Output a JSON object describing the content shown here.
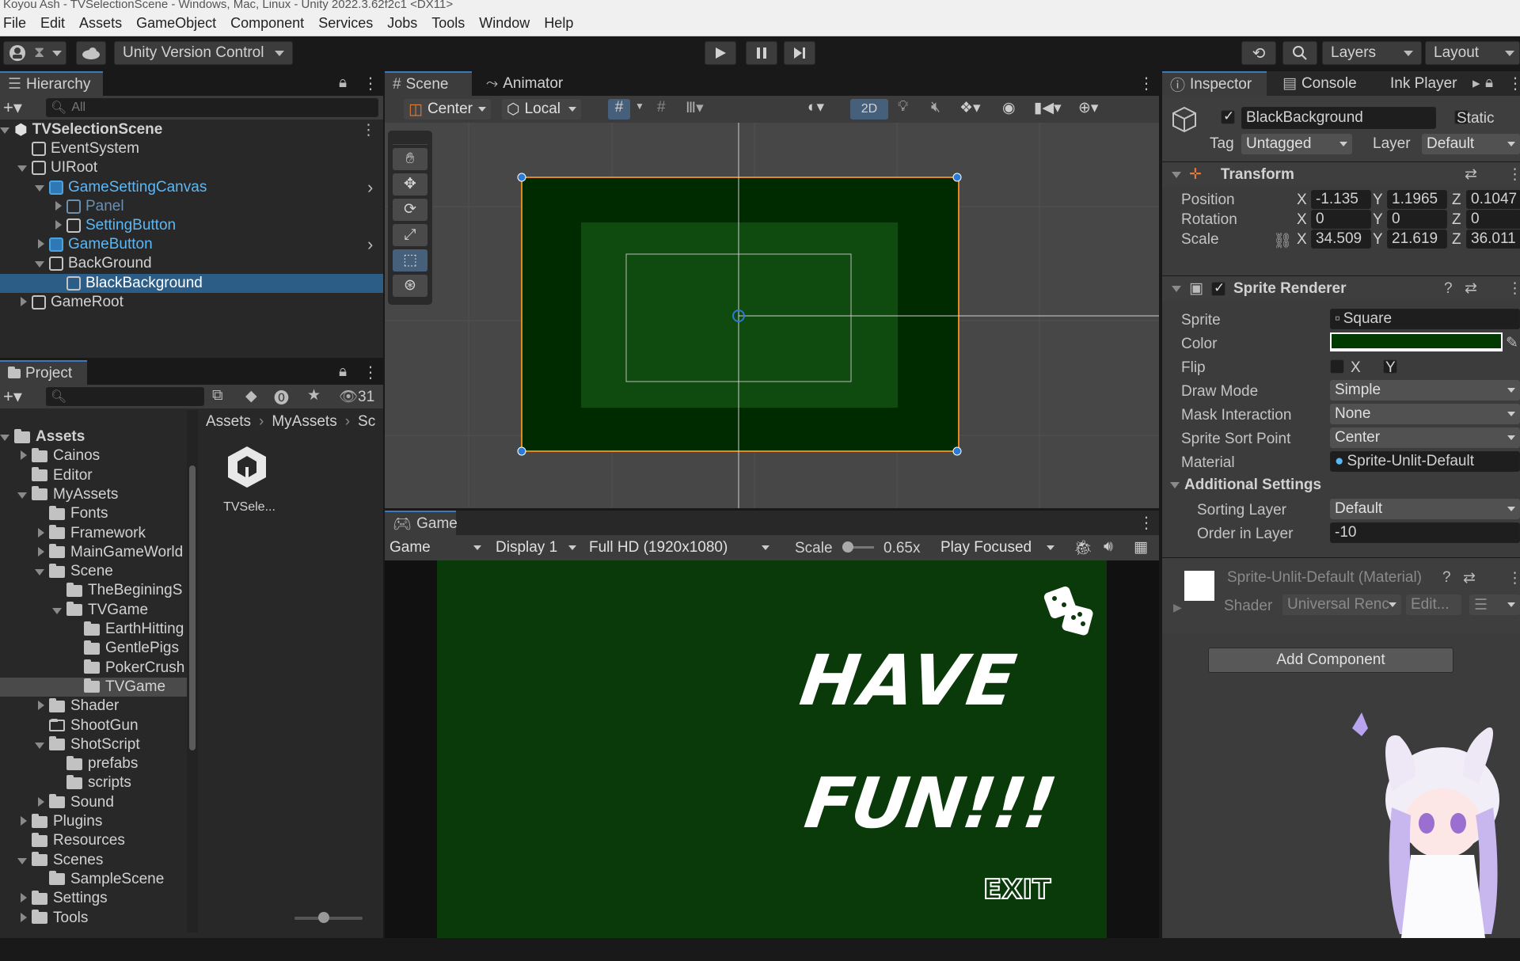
{
  "window": {
    "title": "Koyou Ash - TVSelectionScene - Windows, Mac, Linux - Unity 2022.3.62f2c1 <DX11>"
  },
  "menu": [
    "File",
    "Edit",
    "Assets",
    "GameObject",
    "Component",
    "Services",
    "Jobs",
    "Tools",
    "Window",
    "Help"
  ],
  "toolbar": {
    "version_control": "Unity Version Control",
    "layers": "Layers",
    "layout": "Layout"
  },
  "hierarchy": {
    "tab": "Hierarchy",
    "search_placeholder": "All",
    "items": [
      {
        "label": "TVSelectionScene",
        "depth": 0,
        "kind": "scene",
        "expanded": true
      },
      {
        "label": "EventSystem",
        "depth": 1,
        "kind": "object"
      },
      {
        "label": "UIRoot",
        "depth": 1,
        "kind": "object",
        "expanded": true
      },
      {
        "label": "GameSettingCanvas",
        "depth": 2,
        "kind": "prefab",
        "expanded": true
      },
      {
        "label": "Panel",
        "depth": 3,
        "kind": "inactive"
      },
      {
        "label": "SettingButton",
        "depth": 3,
        "kind": "prefab-child"
      },
      {
        "label": "GameButton",
        "depth": 2,
        "kind": "prefab"
      },
      {
        "label": "BackGround",
        "depth": 2,
        "kind": "object",
        "expanded": true
      },
      {
        "label": "BlackBackground",
        "depth": 3,
        "kind": "selected"
      },
      {
        "label": "GameRoot",
        "depth": 1,
        "kind": "object"
      }
    ]
  },
  "project": {
    "tab": "Project",
    "count": "31",
    "breadcrumb": [
      "Assets",
      "MyAssets",
      "Sc"
    ],
    "tree": [
      {
        "label": "Assets",
        "depth": 0,
        "bold": true
      },
      {
        "label": "Cainos",
        "depth": 1
      },
      {
        "label": "Editor",
        "depth": 1
      },
      {
        "label": "MyAssets",
        "depth": 1
      },
      {
        "label": "Fonts",
        "depth": 2
      },
      {
        "label": "Framework",
        "depth": 2
      },
      {
        "label": "MainGameWorld",
        "depth": 2
      },
      {
        "label": "Scene",
        "depth": 2
      },
      {
        "label": "TheBeginingS",
        "depth": 3
      },
      {
        "label": "TVGame",
        "depth": 3
      },
      {
        "label": "EarthHitting",
        "depth": 4
      },
      {
        "label": "GentlePigs",
        "depth": 4
      },
      {
        "label": "PokerCrush",
        "depth": 4
      },
      {
        "label": "TVGame",
        "depth": 4,
        "highlight": true
      },
      {
        "label": "Shader",
        "depth": 2
      },
      {
        "label": "ShootGun",
        "depth": 2
      },
      {
        "label": "ShotScript",
        "depth": 2
      },
      {
        "label": "prefabs",
        "depth": 3
      },
      {
        "label": "scripts",
        "depth": 3
      },
      {
        "label": "Sound",
        "depth": 2
      },
      {
        "label": "Plugins",
        "depth": 1
      },
      {
        "label": "Resources",
        "depth": 1
      },
      {
        "label": "Scenes",
        "depth": 1
      },
      {
        "label": "SampleScene",
        "depth": 2
      },
      {
        "label": "Settings",
        "depth": 1
      },
      {
        "label": "Tools",
        "depth": 1
      }
    ],
    "asset_name": "TVSele..."
  },
  "scene": {
    "tabs": [
      "Scene",
      "Animator"
    ],
    "pivot": "Center",
    "space": "Local",
    "mode_2d": "2D"
  },
  "game": {
    "tab": "Game",
    "view": "Game",
    "display": "Display 1",
    "resolution": "Full HD (1920x1080)",
    "scale_label": "Scale",
    "scale_value": "0.65x",
    "play_mode": "Play Focused",
    "title_line1": "HAVE",
    "title_line2": "FUN!!!",
    "exit_label": "EXIT"
  },
  "inspector": {
    "tabs": [
      "Inspector",
      "Console",
      "Ink Player"
    ],
    "object_name": "BlackBackground",
    "static_label": "Static",
    "tag_label": "Tag",
    "tag_value": "Untagged",
    "layer_label": "Layer",
    "layer_value": "Default",
    "transform": {
      "title": "Transform",
      "position": {
        "label": "Position",
        "x": "-1.135",
        "y": "1.1965",
        "z": "0.1047"
      },
      "rotation": {
        "label": "Rotation",
        "x": "0",
        "y": "0",
        "z": "0"
      },
      "scale": {
        "label": "Scale",
        "x": "34.509",
        "y": "21.619",
        "z": "36.011"
      }
    },
    "sprite_renderer": {
      "title": "Sprite Renderer",
      "sprite_label": "Sprite",
      "sprite_value": "Square",
      "color_label": "Color",
      "color_value": "#003a00",
      "flip_label": "Flip",
      "flip_x": "X",
      "flip_y": "Y",
      "draw_mode_label": "Draw Mode",
      "draw_mode_value": "Simple",
      "mask_label": "Mask Interaction",
      "mask_value": "None",
      "sort_point_label": "Sprite Sort Point",
      "sort_point_value": "Center",
      "material_label": "Material",
      "material_value": "Sprite-Unlit-Default",
      "additional_title": "Additional Settings",
      "sorting_layer_label": "Sorting Layer",
      "sorting_layer_value": "Default",
      "order_label": "Order in Layer",
      "order_value": "-10"
    },
    "material": {
      "title": "Sprite-Unlit-Default (Material)",
      "shader_label": "Shader",
      "shader_value": "Universal Renc",
      "edit_label": "Edit..."
    },
    "add_component": "Add Component"
  }
}
